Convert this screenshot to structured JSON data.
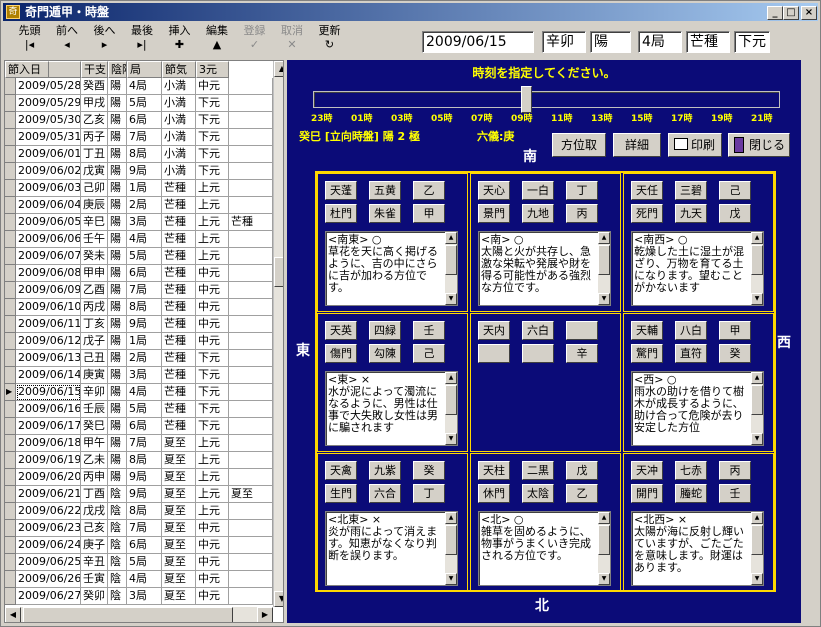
{
  "window": {
    "title": "奇門遁甲・時盤"
  },
  "toolbar": [
    {
      "label": "先頭",
      "icon": "|◂"
    },
    {
      "label": "前へ",
      "icon": "◂"
    },
    {
      "label": "後へ",
      "icon": "▸"
    },
    {
      "label": "最後",
      "icon": "▸|"
    },
    {
      "label": "挿入",
      "icon": "✚"
    },
    {
      "label": "編集",
      "icon": "▲"
    },
    {
      "label": "登録",
      "icon": "✓",
      "disabled": true
    },
    {
      "label": "取消",
      "icon": "✕",
      "disabled": true
    },
    {
      "label": "更新",
      "icon": "↻"
    }
  ],
  "header_fields": {
    "date": "2009/06/15",
    "kanshi": "辛卯",
    "inyo": "陽",
    "kyoku": "4局",
    "sekki": "芒種",
    "gen": "下元"
  },
  "grid": {
    "columns": [
      "日",
      "干支",
      "陰陽",
      "局",
      "節気",
      "3元",
      "節入日"
    ],
    "selected_index": 18,
    "rows": [
      [
        "2009/05/28",
        "癸酉",
        "陽",
        "4局",
        "小満",
        "中元",
        ""
      ],
      [
        "2009/05/29",
        "甲戌",
        "陽",
        "5局",
        "小満",
        "下元",
        ""
      ],
      [
        "2009/05/30",
        "乙亥",
        "陽",
        "6局",
        "小満",
        "下元",
        ""
      ],
      [
        "2009/05/31",
        "丙子",
        "陽",
        "7局",
        "小満",
        "下元",
        ""
      ],
      [
        "2009/06/01",
        "丁丑",
        "陽",
        "8局",
        "小満",
        "下元",
        ""
      ],
      [
        "2009/06/02",
        "戊寅",
        "陽",
        "9局",
        "小満",
        "下元",
        ""
      ],
      [
        "2009/06/03",
        "己卯",
        "陽",
        "1局",
        "芒種",
        "上元",
        ""
      ],
      [
        "2009/06/04",
        "庚辰",
        "陽",
        "2局",
        "芒種",
        "上元",
        ""
      ],
      [
        "2009/06/05",
        "辛巳",
        "陽",
        "3局",
        "芒種",
        "上元",
        "芒種"
      ],
      [
        "2009/06/06",
        "壬午",
        "陽",
        "4局",
        "芒種",
        "上元",
        ""
      ],
      [
        "2009/06/07",
        "癸未",
        "陽",
        "5局",
        "芒種",
        "上元",
        ""
      ],
      [
        "2009/06/08",
        "甲申",
        "陽",
        "6局",
        "芒種",
        "中元",
        ""
      ],
      [
        "2009/06/09",
        "乙酉",
        "陽",
        "7局",
        "芒種",
        "中元",
        ""
      ],
      [
        "2009/06/10",
        "丙戌",
        "陽",
        "8局",
        "芒種",
        "中元",
        ""
      ],
      [
        "2009/06/11",
        "丁亥",
        "陽",
        "9局",
        "芒種",
        "中元",
        ""
      ],
      [
        "2009/06/12",
        "戊子",
        "陽",
        "1局",
        "芒種",
        "中元",
        ""
      ],
      [
        "2009/06/13",
        "己丑",
        "陽",
        "2局",
        "芒種",
        "下元",
        ""
      ],
      [
        "2009/06/14",
        "庚寅",
        "陽",
        "3局",
        "芒種",
        "下元",
        ""
      ],
      [
        "2009/06/15",
        "辛卯",
        "陽",
        "4局",
        "芒種",
        "下元",
        ""
      ],
      [
        "2009/06/16",
        "壬辰",
        "陽",
        "5局",
        "芒種",
        "下元",
        ""
      ],
      [
        "2009/06/17",
        "癸巳",
        "陽",
        "6局",
        "芒種",
        "下元",
        ""
      ],
      [
        "2009/06/18",
        "甲午",
        "陽",
        "7局",
        "夏至",
        "上元",
        ""
      ],
      [
        "2009/06/19",
        "乙未",
        "陽",
        "8局",
        "夏至",
        "上元",
        ""
      ],
      [
        "2009/06/20",
        "丙申",
        "陽",
        "9局",
        "夏至",
        "上元",
        ""
      ],
      [
        "2009/06/21",
        "丁酉",
        "陰",
        "9局",
        "夏至",
        "上元",
        "夏至"
      ],
      [
        "2009/06/22",
        "戊戌",
        "陰",
        "8局",
        "夏至",
        "上元",
        ""
      ],
      [
        "2009/06/23",
        "己亥",
        "陰",
        "7局",
        "夏至",
        "中元",
        ""
      ],
      [
        "2009/06/24",
        "庚子",
        "陰",
        "6局",
        "夏至",
        "中元",
        ""
      ],
      [
        "2009/06/25",
        "辛丑",
        "陰",
        "5局",
        "夏至",
        "中元",
        ""
      ],
      [
        "2009/06/26",
        "壬寅",
        "陰",
        "4局",
        "夏至",
        "中元",
        ""
      ],
      [
        "2009/06/27",
        "癸卯",
        "陰",
        "3局",
        "夏至",
        "中元",
        ""
      ]
    ]
  },
  "panel": {
    "prompt": "時刻を指定してください。",
    "slider_ticks": [
      "23時",
      "01時",
      "03時",
      "05時",
      "07時",
      "09時",
      "11時",
      "13時",
      "15時",
      "17時",
      "19時",
      "21時"
    ],
    "slider_position_index": 5,
    "info": "癸巳 [立向時盤] 陽 2 極",
    "rokugi": "六儀:庚",
    "directions": {
      "south": "南",
      "north": "北",
      "east": "東",
      "west": "西"
    },
    "buttons": {
      "houi": "方位取",
      "detail": "詳細",
      "print": "印刷",
      "close": "閉じる"
    },
    "palaces": [
      {
        "chips": [
          "天蓬",
          "五黄",
          "乙",
          "杜門",
          "朱雀",
          "甲"
        ],
        "text": "<南東> ○\n草花を天に高く掲げるように、吉の中にさらに吉が加わる方位です。"
      },
      {
        "chips": [
          "天心",
          "一白",
          "丁",
          "景門",
          "九地",
          "丙"
        ],
        "text": "<南> ○\n太陽と火が共存し、急激な栄転や発展や財を得る可能性がある強烈な方位です。"
      },
      {
        "chips": [
          "天任",
          "三碧",
          "己",
          "死門",
          "九天",
          "戊"
        ],
        "text": "<南西> ○\n乾燥した土に湿土が混ざり、万物を育てる土になります。望むことがかないます"
      },
      {
        "chips": [
          "天英",
          "四緑",
          "壬",
          "傷門",
          "勾陳",
          "己"
        ],
        "text": "<東> ×\n水が泥によって濁流になるように、男性は仕事で大失敗し女性は男に騙されます"
      },
      {
        "chips": [
          "天内",
          "六白",
          "",
          "",
          "",
          "辛"
        ],
        "text": ""
      },
      {
        "chips": [
          "天輔",
          "八白",
          "甲",
          "驚門",
          "直符",
          "癸"
        ],
        "text": "<西> ○\n雨水の助けを借りて樹木が成長するように、助け合って危険が去り安定した方位"
      },
      {
        "chips": [
          "天禽",
          "九紫",
          "癸",
          "生門",
          "六合",
          "丁"
        ],
        "text": "<北東> ×\n炎が雨によって消えます。知恵がなくなり判断を誤ります。"
      },
      {
        "chips": [
          "天柱",
          "二黒",
          "戊",
          "休門",
          "太陰",
          "乙"
        ],
        "text": "<北> ○\n雑草を固めるように、物事がうまくいき完成される方位です。"
      },
      {
        "chips": [
          "天冲",
          "七赤",
          "丙",
          "開門",
          "螣蛇",
          "壬"
        ],
        "text": "<北西> ×\n太陽が海に反射し輝いていますが、ごたごたを意味します。財運はあります。"
      }
    ]
  }
}
